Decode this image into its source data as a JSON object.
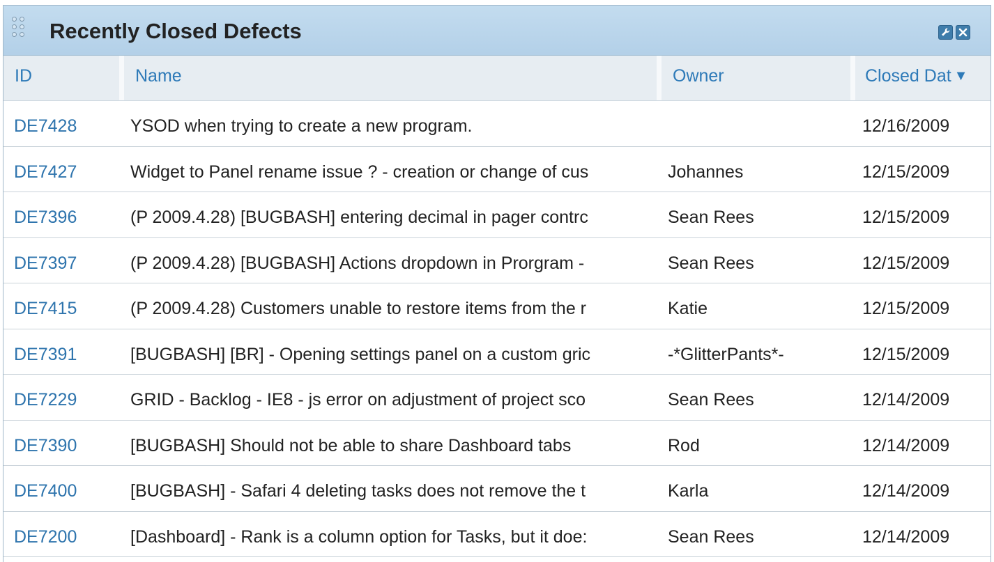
{
  "panel": {
    "title": "Recently Closed Defects"
  },
  "columns": {
    "id": "ID",
    "name": "Name",
    "owner": "Owner",
    "closed_date": "Closed Dat",
    "sort_indicator": "▼"
  },
  "rows": [
    {
      "id": "DE7428",
      "name": "YSOD when trying to create a new program.",
      "owner": "",
      "date": "12/16/2009"
    },
    {
      "id": "DE7427",
      "name": "Widget to Panel rename issue ? - creation or change of cus",
      "owner": "Johannes",
      "date": "12/15/2009"
    },
    {
      "id": "DE7396",
      "name": "(P 2009.4.28) [BUGBASH] entering decimal in pager contrc",
      "owner": "Sean Rees",
      "date": "12/15/2009"
    },
    {
      "id": "DE7397",
      "name": "(P 2009.4.28) [BUGBASH] Actions dropdown in Prorgram -",
      "owner": "Sean Rees",
      "date": "12/15/2009"
    },
    {
      "id": "DE7415",
      "name": "(P 2009.4.28) Customers unable to restore items from the r",
      "owner": "Katie",
      "date": "12/15/2009"
    },
    {
      "id": "DE7391",
      "name": "[BUGBASH] [BR] - Opening settings panel on a custom gric",
      "owner": "-*GlitterPants*-",
      "date": "12/15/2009"
    },
    {
      "id": "DE7229",
      "name": "GRID - Backlog - IE8 - js error on adjustment of project sco",
      "owner": "Sean Rees",
      "date": "12/14/2009"
    },
    {
      "id": "DE7390",
      "name": "[BUGBASH] Should not be able to share Dashboard tabs",
      "owner": "Rod",
      "date": "12/14/2009"
    },
    {
      "id": "DE7400",
      "name": "[BUGBASH] - Safari 4 deleting tasks does not remove the t",
      "owner": "Karla",
      "date": "12/14/2009"
    },
    {
      "id": "DE7200",
      "name": "[Dashboard] - Rank is a column option for Tasks, but it doe:",
      "owner": "Sean Rees",
      "date": "12/14/2009"
    }
  ],
  "icons": {
    "drag_handle": "grip-icon",
    "settings": "wrench-icon",
    "close": "close-icon"
  },
  "colors": {
    "titlebar": "#b9d5eb",
    "header_text": "#2e7ab8",
    "link": "#2e74ad"
  }
}
